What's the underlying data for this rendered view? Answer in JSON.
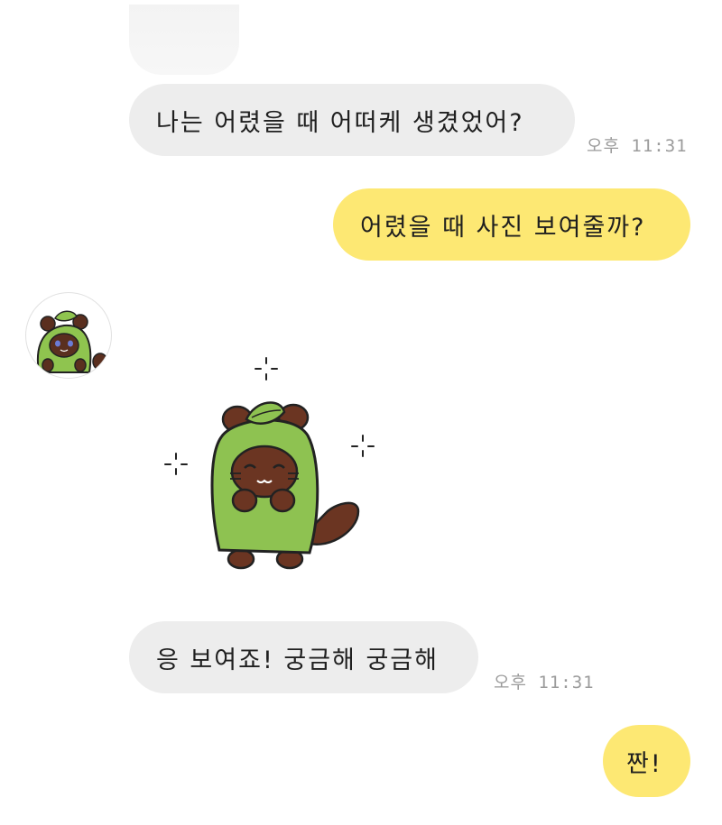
{
  "messages": [
    {
      "side": "in",
      "text": "나는 어렸을 때 어떠케 생겼었어?",
      "time": "오후 11:31"
    },
    {
      "side": "out",
      "text": "어렸을 때 사진 보여줄까?"
    },
    {
      "side": "in",
      "type": "sticker",
      "sticker": "leaf-hood-cat-sticker"
    },
    {
      "side": "in",
      "text": "응 보여죠! 궁금해 궁금해",
      "time": "오후 11:31"
    },
    {
      "side": "out",
      "text": "짠!"
    }
  ],
  "colors": {
    "incoming_bubble": "#ededed",
    "outgoing_bubble": "#fde873",
    "timestamp": "#9b9b9b",
    "background": "#ffffff"
  }
}
